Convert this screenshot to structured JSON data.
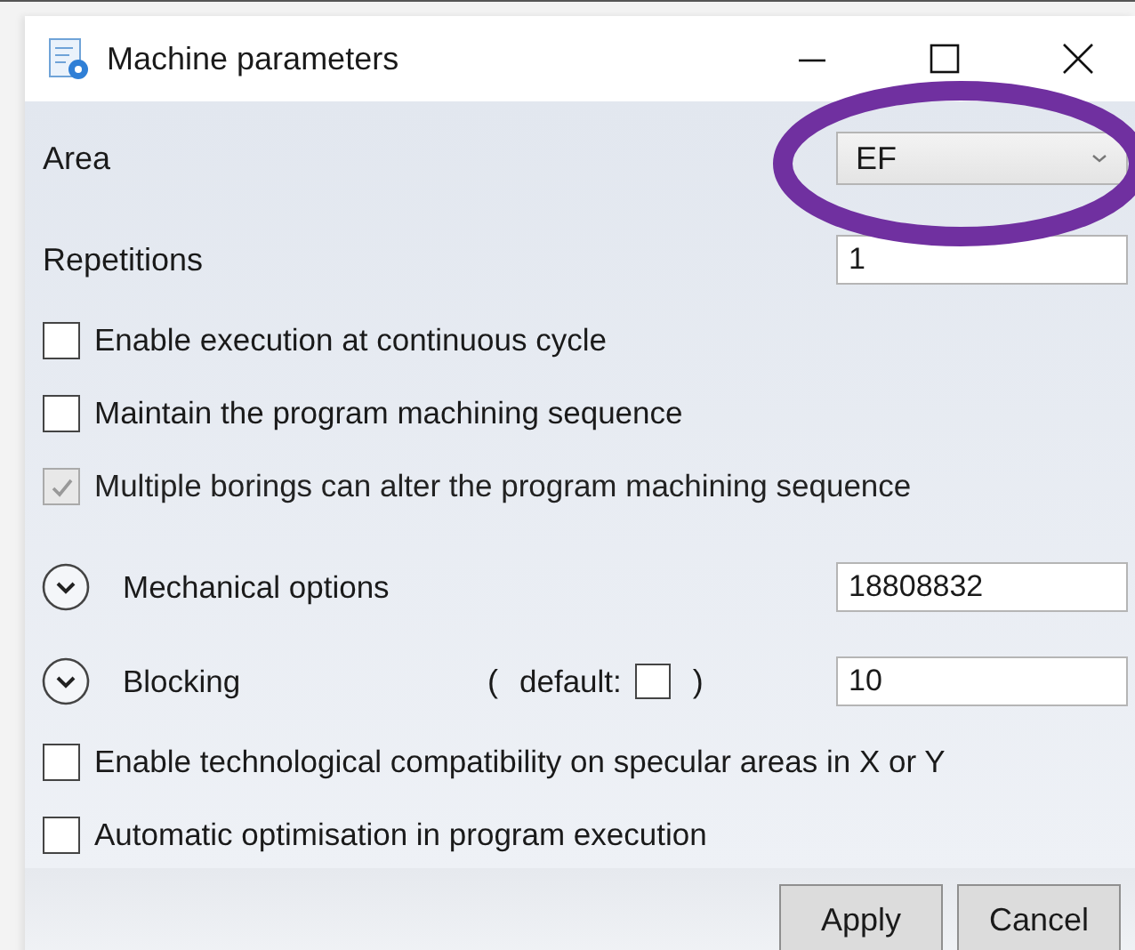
{
  "window": {
    "title": "Machine parameters"
  },
  "area": {
    "label": "Area",
    "value": "EF"
  },
  "repetitions": {
    "label": "Repetitions",
    "value": "1"
  },
  "options": [
    {
      "label": "Enable execution at continuous cycle",
      "checked": false,
      "disabled": false
    },
    {
      "label": "Maintain the program machining sequence",
      "checked": false,
      "disabled": false
    },
    {
      "label": "Multiple borings can alter the program machining sequence",
      "checked": true,
      "disabled": true
    }
  ],
  "mechanical_options": {
    "label": "Mechanical options",
    "value": "18808832"
  },
  "blocking": {
    "label": "Blocking",
    "open_paren": "(",
    "default_label": "default:",
    "default_checked": false,
    "close_paren": ")",
    "value": "10"
  },
  "more_options": [
    {
      "label": "Enable technological compatibility on specular areas in X or Y",
      "checked": false,
      "disabled": false
    },
    {
      "label": "Automatic optimisation in program execution",
      "checked": false,
      "disabled": false
    }
  ],
  "buttons": [
    "Apply",
    "Cancel"
  ]
}
